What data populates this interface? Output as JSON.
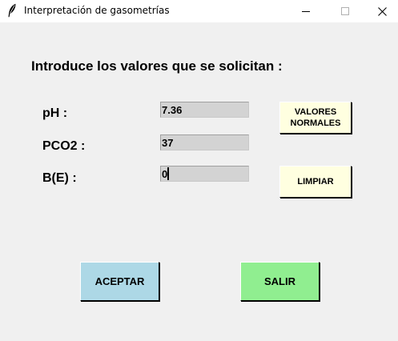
{
  "window": {
    "title": "Interpretación de gasometrías",
    "controls": {
      "minimize": "minimize-icon",
      "maximize": "maximize-icon",
      "close": "close-icon"
    },
    "title_icon": "feather-icon"
  },
  "heading": "Introduce los valores que se solicitan :",
  "fields": [
    {
      "label": "pH :",
      "value": "7.36"
    },
    {
      "label": "PCO2 :",
      "value": "37"
    },
    {
      "label": "B(E) :",
      "value": "0"
    }
  ],
  "buttons": {
    "valores_normales": "VALORES\nNORMALES",
    "limpiar": "LIMPIAR",
    "aceptar": "ACEPTAR",
    "salir": "SALIR"
  },
  "colors": {
    "window_bg": "#f0f0f0",
    "entry_bg": "#d3d3d3",
    "side_button_bg": "#ffffe0",
    "aceptar_bg": "#add8e6",
    "salir_bg": "#90ee90"
  }
}
